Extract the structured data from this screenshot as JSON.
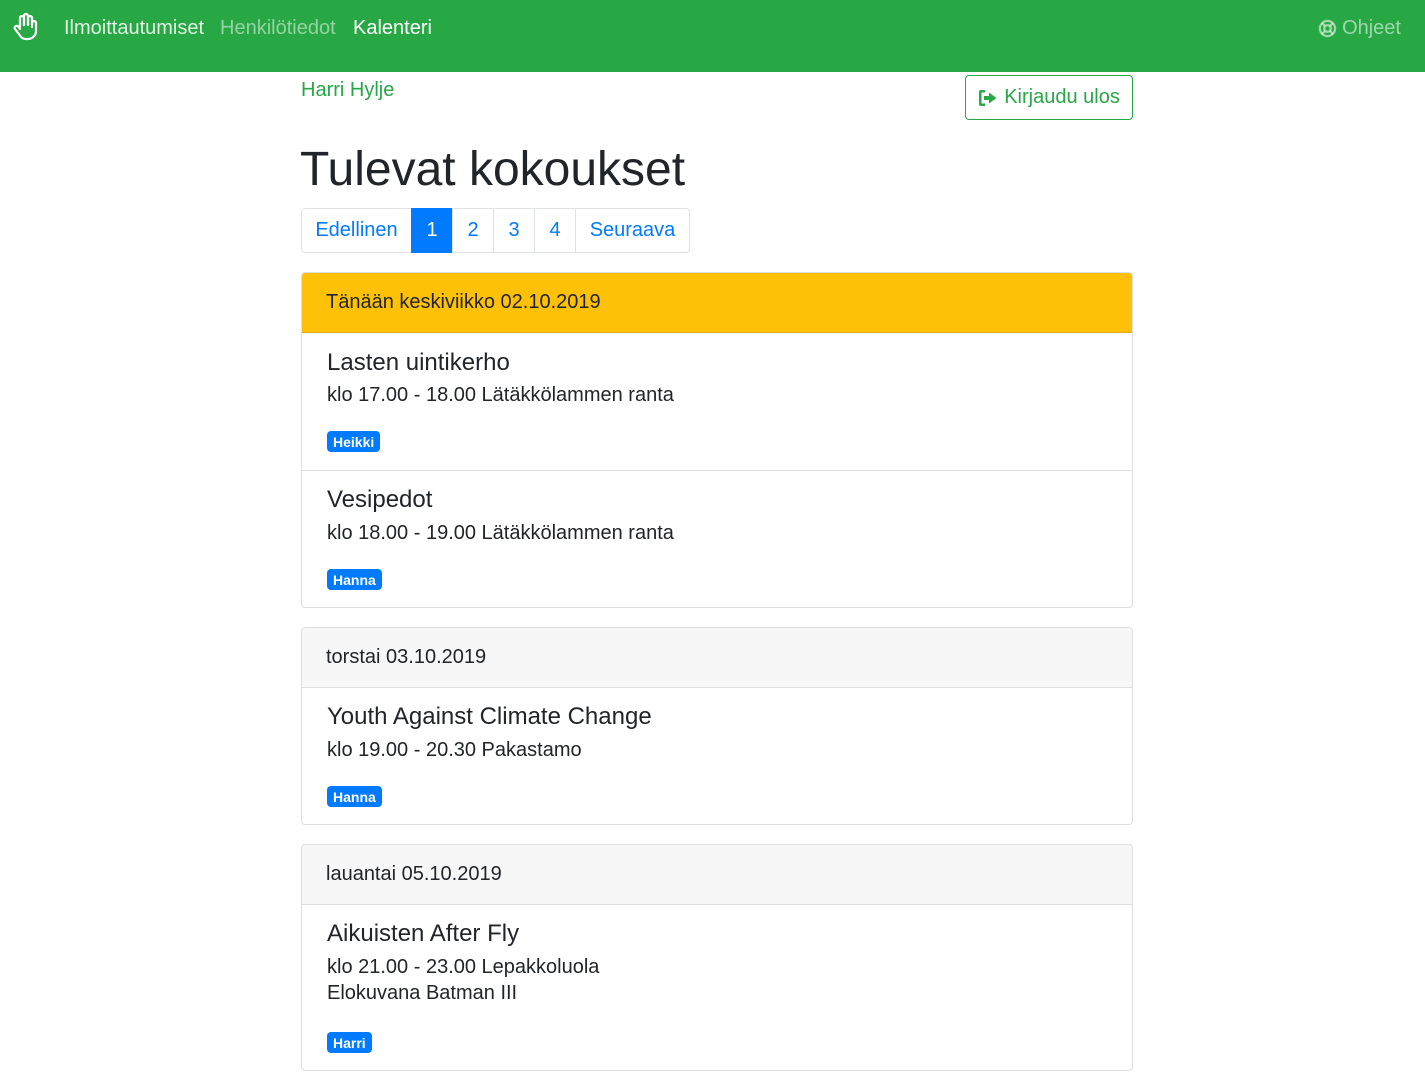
{
  "nav": {
    "items": [
      {
        "label": "Ilmoittautumiset"
      },
      {
        "label": "Henkilötiedot"
      },
      {
        "label": "Kalenteri"
      }
    ],
    "help_label": "Ohjeet",
    "brand_icon": "hand-icon",
    "help_icon": "life-ring-icon"
  },
  "user": {
    "name": "Harri Hylje",
    "logout_label": "Kirjaudu ulos",
    "logout_icon": "sign-out-icon"
  },
  "page": {
    "title": "Tulevat kokoukset"
  },
  "pagination": {
    "prev_label": "Edellinen",
    "pages": [
      "1",
      "2",
      "3",
      "4"
    ],
    "current": "1",
    "next_label": "Seuraava"
  },
  "days": [
    {
      "header": "Tänään keskiviikko 02.10.2019",
      "today": true,
      "events": [
        {
          "title": "Lasten uintikerho",
          "details": "klo 17.00 - 18.00 Lätäkkölammen ranta",
          "badge": "Heikki"
        },
        {
          "title": "Vesipedot",
          "details": "klo 18.00 - 19.00 Lätäkkölammen ranta",
          "badge": "Hanna"
        }
      ]
    },
    {
      "header": "torstai 03.10.2019",
      "today": false,
      "events": [
        {
          "title": "Youth Against Climate Change",
          "details": "klo 19.00 - 20.30 Pakastamo",
          "badge": "Hanna"
        }
      ]
    },
    {
      "header": "lauantai 05.10.2019",
      "today": false,
      "events": [
        {
          "title": "Aikuisten After Fly",
          "details": "klo 21.00 - 23.00 Lepakkoluola",
          "description": "Elokuvana Batman III",
          "badge": "Harri"
        }
      ]
    }
  ],
  "colors": {
    "navbar": "#28a745",
    "primary": "#007bff",
    "today_header": "#ffc107",
    "card_header": "#f7f7f7"
  }
}
